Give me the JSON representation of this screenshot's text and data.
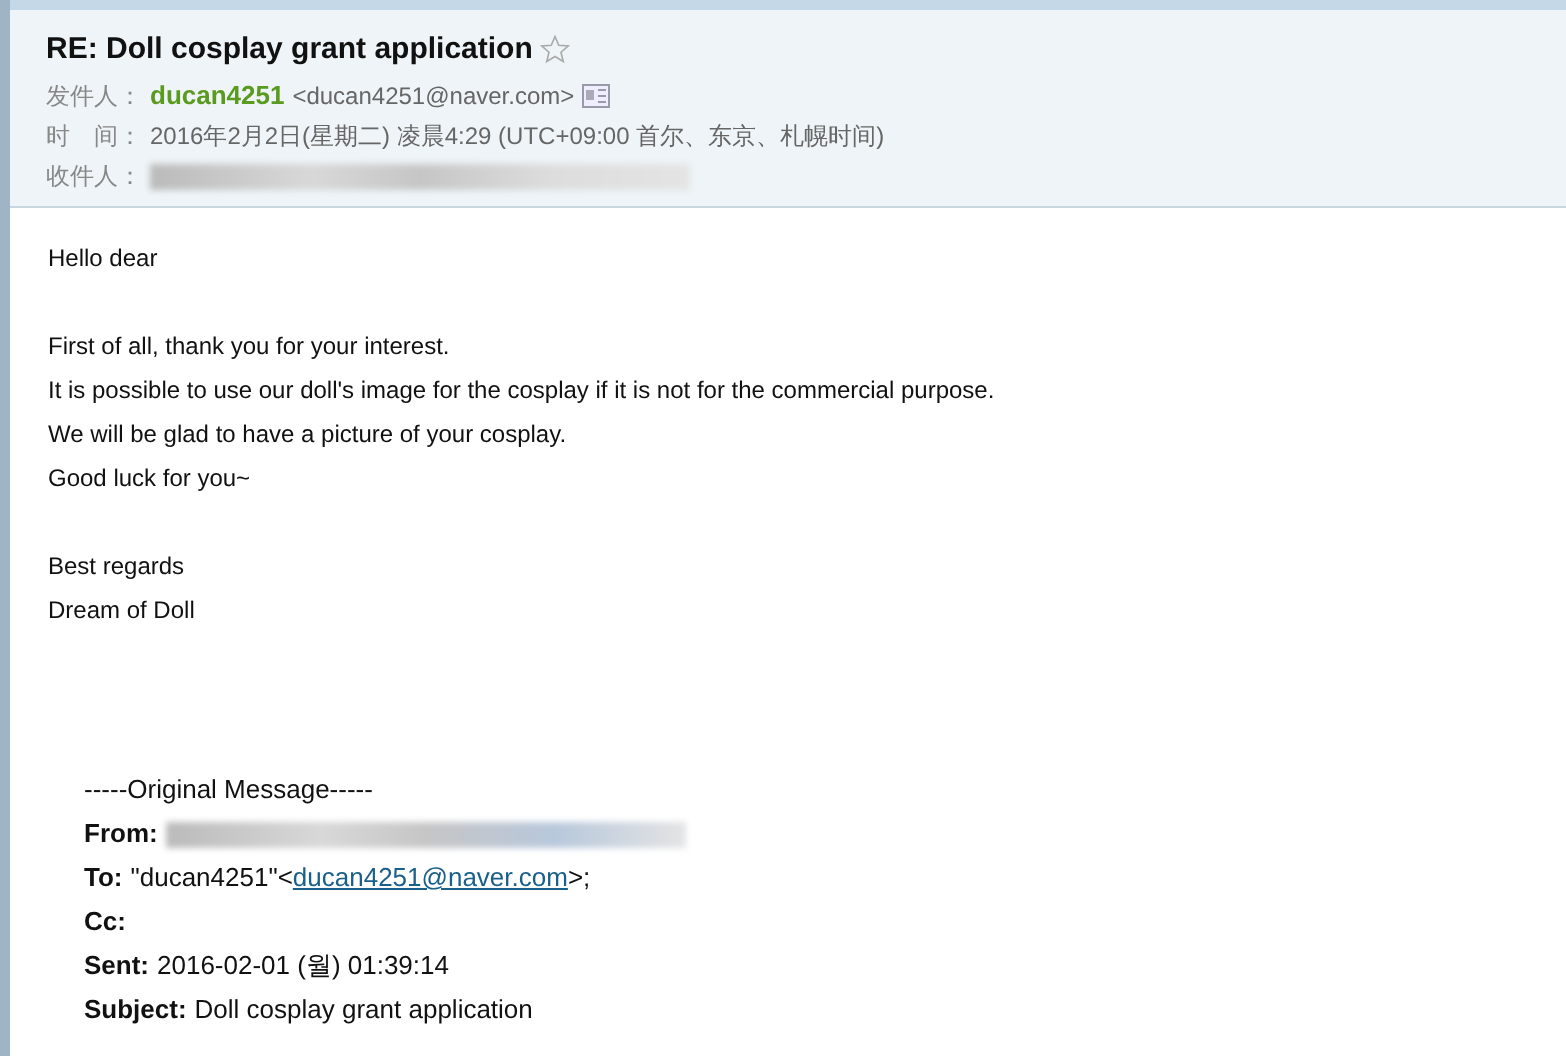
{
  "header": {
    "subject": "RE: Doll cosplay grant application",
    "starred": false,
    "from": {
      "label": "发件人：",
      "name": "ducan4251",
      "address": "<ducan4251@naver.com>"
    },
    "time": {
      "label": "时　间：",
      "value": "2016年2月2日(星期二) 凌晨4:29 (UTC+09:00 首尔、东京、札幌时间)"
    },
    "to": {
      "label": "收件人："
    }
  },
  "body": {
    "paragraphs": [
      [
        "Hello dear"
      ],
      [
        "First of all, thank you for your interest.",
        "It is possible to use our doll's image for the cosplay if it is not for the commercial purpose.",
        "We will be glad to have a picture of your cosplay.",
        "Good luck for you~"
      ],
      [
        "Best regards",
        "Dream of Doll"
      ]
    ]
  },
  "original": {
    "separator": "-----Original Message-----",
    "fields": [
      {
        "label": "From:",
        "kind": "redacted"
      },
      {
        "label": "To:",
        "kind": "link",
        "prefix": "\"ducan4251\"<",
        "link": "ducan4251@naver.com",
        "suffix": ">;"
      },
      {
        "label": "Cc:",
        "kind": "text"
      },
      {
        "label": "Sent:",
        "kind": "text",
        "value": "2016-02-01 (월) 01:39:14"
      },
      {
        "label": "Subject:",
        "kind": "text",
        "value": "Doll cosplay grant application"
      }
    ]
  }
}
